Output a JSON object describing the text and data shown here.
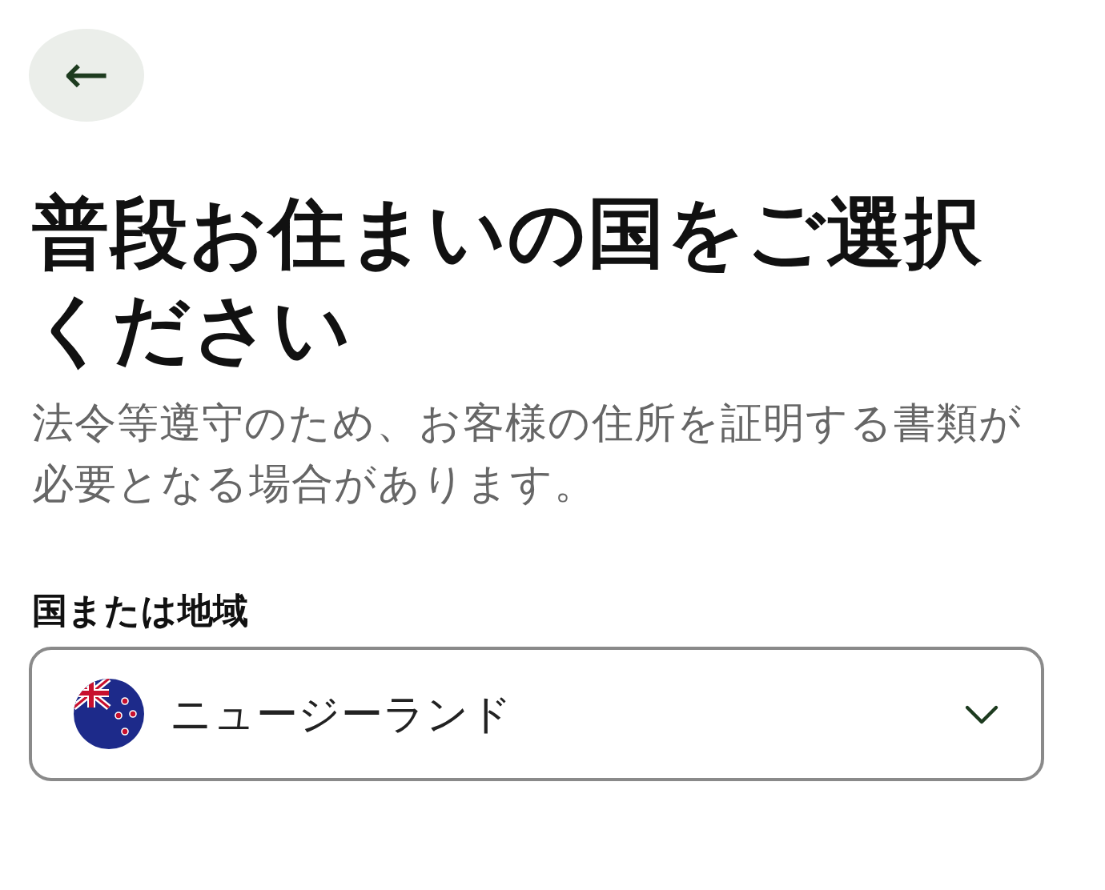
{
  "back_button": {
    "label": "←"
  },
  "title": "普段お住まいの国をご選択ください",
  "description": "法令等遵守のため、お客様の住所を証明する書類が必要となる場合があります。",
  "country_field": {
    "label": "国または地域",
    "value": "ニュージーランド"
  }
}
